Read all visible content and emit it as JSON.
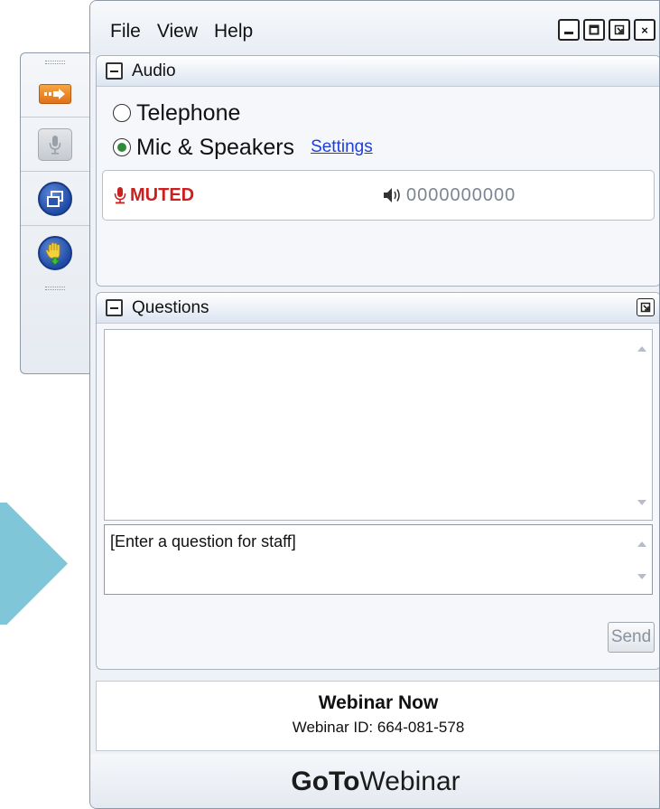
{
  "menu": {
    "file": "File",
    "view": "View",
    "help": "Help"
  },
  "window_controls": {
    "minimize_icon": "minimize-icon",
    "restore_icon": "restore-icon",
    "popout_icon": "popout-icon",
    "close": "×"
  },
  "toolbar": {
    "arrow_icon": "show-panel-arrow-icon",
    "mic_icon": "microphone-icon",
    "window_icon": "window-icon",
    "hand_icon": "raise-hand-icon"
  },
  "audio": {
    "title": "Audio",
    "options": [
      "Telephone",
      "Mic & Speakers"
    ],
    "selected": "Mic & Speakers",
    "settings_link": "Settings",
    "status": "MUTED",
    "level_meter": "0000000000"
  },
  "questions": {
    "title": "Questions",
    "input_placeholder": "[Enter a question for staff]",
    "send_label": "Send"
  },
  "webinar": {
    "name": "Webinar Now",
    "id_text": "Webinar ID: 664-081-578"
  },
  "brand": {
    "part1": "GoTo",
    "part2": "Webinar"
  },
  "colors": {
    "accent_teal": "#7fc6d9",
    "muted_red": "#cc1f1f",
    "link_blue": "#1d3fd8",
    "radio_green": "#2f8a3a"
  }
}
